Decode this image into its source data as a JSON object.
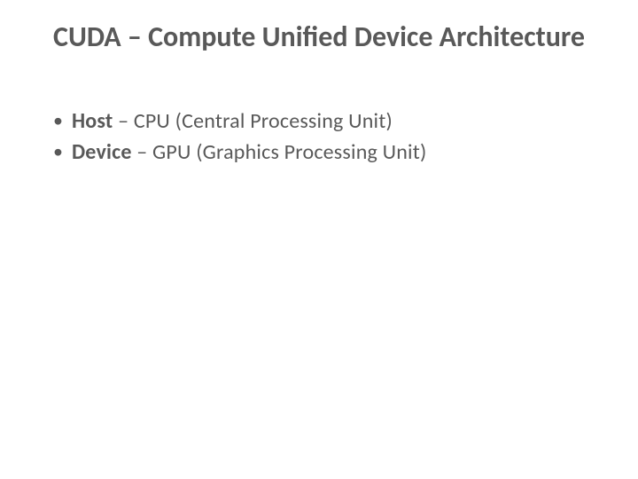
{
  "title": "CUDA – Compute Unified Device Architecture",
  "bullets": [
    {
      "term": "Host",
      "desc": " – CPU (Central Processing Unit)"
    },
    {
      "term": "Device",
      "desc": " – GPU (Graphics Processing Unit)"
    }
  ]
}
